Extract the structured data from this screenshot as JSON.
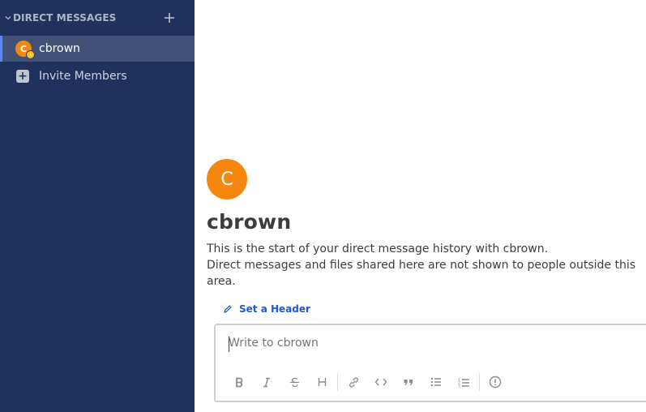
{
  "sidebar": {
    "section_title": "DIRECT MESSAGES",
    "channels": [
      {
        "label": "cbrown",
        "avatar_letter": "C",
        "status": "away",
        "active": true
      }
    ],
    "invite_label": "Invite Members"
  },
  "intro": {
    "avatar_letter": "C",
    "name": "cbrown",
    "line1": "This is the start of your direct message history with cbrown.",
    "line2": "Direct messages and files shared here are not shown to people outside this area.",
    "set_header": "Set a Header"
  },
  "composer": {
    "placeholder": "Write to cbrown",
    "format_buttons": [
      "bold-icon",
      "italic-icon",
      "strikethrough-icon",
      "heading-icon",
      "link-icon",
      "code-icon",
      "quote-icon",
      "bulleted-list-icon",
      "numbered-list-icon",
      "info-icon"
    ]
  },
  "colors": {
    "sidebar_bg": "#1e325c",
    "active_border": "#5d89ea",
    "avatar_orange": "#f5870f",
    "away": "#ffbc1f",
    "link": "#1c58d9"
  }
}
